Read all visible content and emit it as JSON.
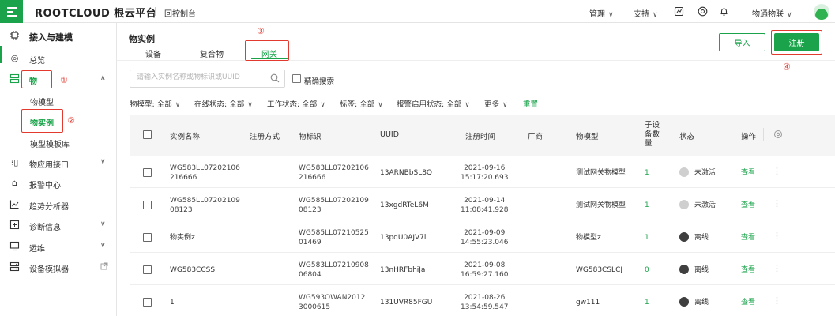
{
  "topbar": {
    "logo": "ROOTCLOUD 根云平台",
    "console": "回控制台",
    "nav": [
      {
        "label": "管理"
      },
      {
        "label": "支持"
      }
    ],
    "user": "物通物联"
  },
  "sidebar": {
    "section_title": "接入与建模",
    "items": [
      {
        "label": "总览",
        "icon": "dashboard-icon"
      },
      {
        "label": "物",
        "icon": "grid-icon"
      },
      {
        "label": "物应用接口",
        "icon": "api-icon"
      },
      {
        "label": "报警中心",
        "icon": "alarm-icon"
      },
      {
        "label": "趋势分析器",
        "icon": "chart-icon"
      },
      {
        "label": "诊断信息",
        "icon": "diagnosis-icon"
      },
      {
        "label": "运维",
        "icon": "monitor-icon"
      },
      {
        "label": "设备模拟器",
        "icon": "simulator-icon"
      }
    ],
    "sub_items": [
      "物模型",
      "物实例",
      "模型模板库"
    ]
  },
  "main": {
    "title": "物实例",
    "tabs": [
      "设备",
      "复合物",
      "网关"
    ],
    "import_label": "导入",
    "register_label": "注册",
    "search_placeholder": "请输入实例名称或物标识或UUID",
    "exact_search": "精确搜索",
    "filters": [
      "物模型: 全部",
      "在线状态: 全部",
      "工作状态: 全部",
      "标签: 全部",
      "报警启用状态: 全部",
      "更多"
    ],
    "reset": "重置"
  },
  "annotations": [
    "①",
    "②",
    "③",
    "④"
  ],
  "table": {
    "headers": [
      "实例名称",
      "注册方式",
      "物标识",
      "UUID",
      "注册时间",
      "厂商",
      "物模型",
      "子设备数量",
      "状态",
      "操作"
    ],
    "child_count_header": [
      "子设",
      "备数",
      "量"
    ],
    "rows": [
      {
        "name": [
          "WG583LL07202106",
          "216666"
        ],
        "reg": "",
        "id": [
          "WG583LL07202106",
          "216666"
        ],
        "uuid": "13ARNBbSL8Q",
        "time": [
          "2021-09-16",
          "15:17:20.693"
        ],
        "vendor": "",
        "model": "测试网关物模型",
        "children": "1",
        "status": "未激活",
        "action": "查看"
      },
      {
        "name": [
          "WG585LL07202109",
          "08123"
        ],
        "reg": "",
        "id": [
          "WG585LL07202109",
          "08123"
        ],
        "uuid": "13xgdRTeL6M",
        "time": [
          "2021-09-14",
          "11:08:41.928"
        ],
        "vendor": "",
        "model": "测试网关物模型",
        "children": "1",
        "status": "未激活",
        "action": "查看"
      },
      {
        "name": [
          "物实例z"
        ],
        "reg": "",
        "id": [
          "WG585LL07210525",
          "01469"
        ],
        "uuid": "13pdU0AJV7i",
        "time": [
          "2021-09-09",
          "14:55:23.046"
        ],
        "vendor": "",
        "model": "物模型z",
        "children": "1",
        "status": "离线",
        "action": "查看"
      },
      {
        "name": [
          "WG583CCSS"
        ],
        "reg": "",
        "id": [
          "WG583LL07210908",
          "06804"
        ],
        "uuid": "13nHRFbhiJa",
        "time": [
          "2021-09-08",
          "16:59:27.160"
        ],
        "vendor": "",
        "model": "WG583CSLCJ",
        "children": "0",
        "status": "离线",
        "action": "查看"
      },
      {
        "name": [
          "1"
        ],
        "reg": "",
        "id": [
          "WG593OWAN2012",
          "3000615"
        ],
        "uuid": "131UVR85FGU",
        "time": [
          "2021-08-26",
          "13:54:59.547"
        ],
        "vendor": "",
        "model": "gw111",
        "children": "1",
        "status": "离线",
        "action": "查看"
      }
    ]
  },
  "colors": {
    "accent": "#1aa34a",
    "annotation": "#e23a2f"
  }
}
